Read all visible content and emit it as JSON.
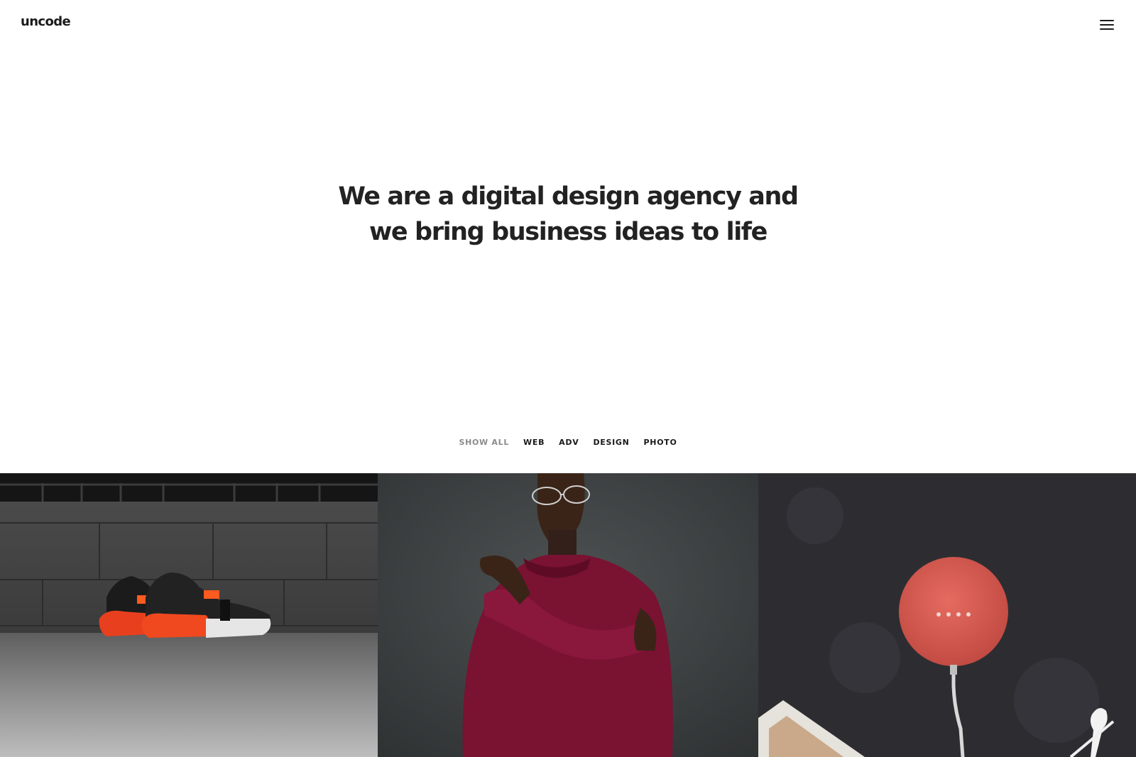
{
  "header": {
    "logo": "uncode",
    "menu_icon": "hamburger-menu-icon"
  },
  "hero": {
    "line1": "We are a digital design agency and",
    "line2": "we bring business ideas to life"
  },
  "filters": {
    "items": [
      {
        "label": "SHOW ALL",
        "active": true
      },
      {
        "label": "WEB",
        "active": false
      },
      {
        "label": "ADV",
        "active": false
      },
      {
        "label": "DESIGN",
        "active": false
      },
      {
        "label": "PHOTO",
        "active": false
      }
    ]
  },
  "portfolio": {
    "items": [
      {
        "subject": "sneakers-photo"
      },
      {
        "subject": "man-in-sweater-photo"
      },
      {
        "subject": "smart-speaker-photo"
      }
    ]
  },
  "colors": {
    "text": "#222222",
    "filter_active": "#8a8a8a",
    "background": "#ffffff"
  }
}
